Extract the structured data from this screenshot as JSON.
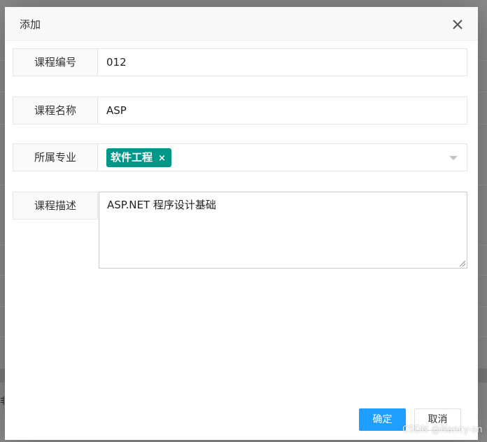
{
  "dialog": {
    "title": "添加",
    "close_icon": "close-icon"
  },
  "form": {
    "course_code": {
      "label": "课程编号",
      "value": "012"
    },
    "course_name": {
      "label": "课程名称",
      "value": "ASP"
    },
    "major": {
      "label": "所属专业",
      "selected_tags": [
        "软件工程"
      ],
      "tag_remove": "×",
      "tag_color": "#009688"
    },
    "description": {
      "label": "课程描述",
      "value": "ASP.NET 程序设计基础"
    }
  },
  "buttons": {
    "confirm_label": "确定",
    "cancel_label": "取消",
    "primary_color": "#1e9fff"
  },
  "background": {
    "partial_char": "非"
  },
  "watermark": "CSDN @Nancy-sn"
}
